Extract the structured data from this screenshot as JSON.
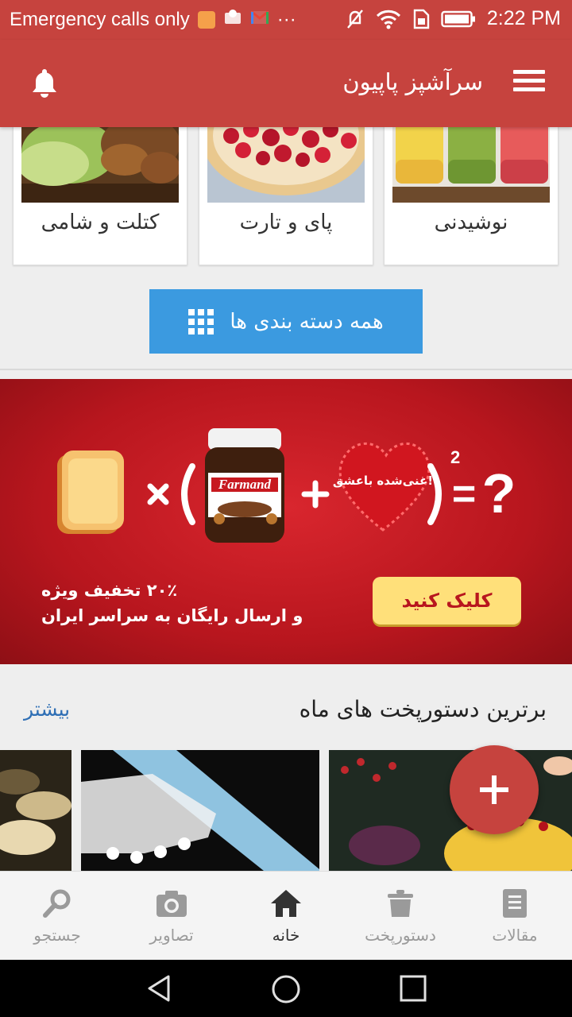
{
  "status_bar": {
    "carrier": "Emergency calls only",
    "time": "2:22 PM",
    "more": "···"
  },
  "app_bar": {
    "title": "سرآشپز پاپیون"
  },
  "categories": [
    {
      "label": "کتلت و شامی"
    },
    {
      "label": "پای و تارت"
    },
    {
      "label": "نوشیدنی"
    }
  ],
  "all_categories_label": "همه دسته بندی ها",
  "banner": {
    "brand": "Farmand",
    "heart_text": "غنی‌شده باعشق!",
    "equation_eq": "=",
    "equation_q": "?",
    "exponent": "2",
    "discount": "۲۰٪ تخفیف ویژه",
    "shipping": "و ارسال رایگان به سراسر ایران",
    "cta": "کلیک کنید"
  },
  "top_recipes": {
    "title": "برترین دستورپخت های ماه",
    "more": "بیشتر"
  },
  "fab_icon": "plus-icon",
  "bottom_nav": [
    {
      "label": "مقالات",
      "icon": "article-icon"
    },
    {
      "label": "دستورپخت",
      "icon": "pot-icon"
    },
    {
      "label": "خانه",
      "icon": "home-icon",
      "active": true
    },
    {
      "label": "تصاویر",
      "icon": "camera-icon"
    },
    {
      "label": "جستجو",
      "icon": "search-icon"
    }
  ],
  "colors": {
    "primary": "#c6433e",
    "accent_button": "#3b9ae0",
    "link": "#2f6fb5",
    "banner_red": "#b8161e"
  }
}
